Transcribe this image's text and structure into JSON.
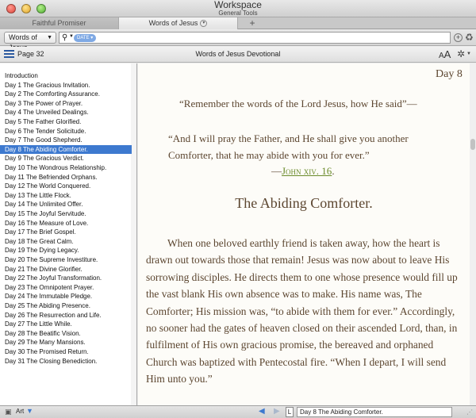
{
  "window": {
    "title": "Workspace",
    "subtitle": "General Tools"
  },
  "tabs": [
    {
      "label": "Faithful Promiser"
    },
    {
      "label": "Words of Jesus"
    }
  ],
  "tab_add_label": "+",
  "toolbar": {
    "resource_select": "Words of Jesus",
    "search_chip": "DATE",
    "search_value": "",
    "search_placeholder": ""
  },
  "panel": {
    "page": "Page 32",
    "title": "Words of Jesus Devotional",
    "text_size_label": "A",
    "text_size_label_large": "A"
  },
  "sidebar": {
    "selected_index": 9,
    "items": [
      "Introduction",
      "Day 1 The Gracious Invitation.",
      "Day 2 The Comforting Assurance.",
      "Day 3 The Power of Prayer.",
      "Day 4 The Unveiled Dealings.",
      "Day 5 The Father Glorified.",
      "Day 6 The Tender Solicitude.",
      "Day 7 The Good Shepherd.",
      "Day 8 The Abiding Comforter.",
      "Day 9 The Gracious Verdict.",
      "Day 10 The Wondrous Relationship.",
      "Day 11 The Befriended Orphans.",
      "Day 12 The World Conquered.",
      "Day 13 The Little Flock.",
      "Day 14 The Unlimited Offer.",
      "Day 15 The Joyful Servitude.",
      "Day 16 The Measure of Love.",
      "Day 17 The Brief Gospel.",
      "Day 18 The Great Calm.",
      "Day 19 The Dying Legacy.",
      "Day 20 The Supreme Investiture.",
      "Day 21 The Divine Glorifier.",
      "Day 22 The Joyful Transformation.",
      "Day 23 The Omnipotent Prayer.",
      "Day 24 The Immutable Pledge.",
      "Day 25 The Abiding Presence.",
      "Day 26 The Resurrection and Life.",
      "Day 27 The Little While.",
      "Day 28 The Beatific Vision.",
      "Day 29 The Many Mansions.",
      "Day 30 The Promised Return.",
      "Day 31 The Closing Benediction."
    ]
  },
  "content": {
    "day_label": "Day 8",
    "quote_intro": "“Remember the words of the Lord Jesus, how He said”—",
    "quote": "“And I will pray the Father, and He shall give you another Comforter, that he may abide with you for ever.”",
    "ref_dash": "—",
    "ref_link": "John xiv. 16",
    "ref_end": ".",
    "heading": "The Abiding Comforter.",
    "body": "When one beloved earthly friend is taken away, how the heart is drawn out towards those that remain! Jesus was now about to leave His sorrowing disciples. He directs them to one whose presence would fill up the vast blank His own absence was to make. His name was, The Comforter; His mission was, “to abide with them for ever.” Accordingly, no sooner had the gates of heaven closed on their ascended Lord, than, in fulfilment of His own gracious promise, the bereaved and orphaned Church was baptized with Pentecostal fire. “When I depart, I will send Him unto you.”"
  },
  "statusbar": {
    "resource_label": "Art",
    "link_label": "L",
    "reference": "Day 8 The Abiding Comforter."
  },
  "colors": {
    "accent": "#3d79cf",
    "text_brown": "#5c4630",
    "link_green": "#6a8a2a"
  }
}
